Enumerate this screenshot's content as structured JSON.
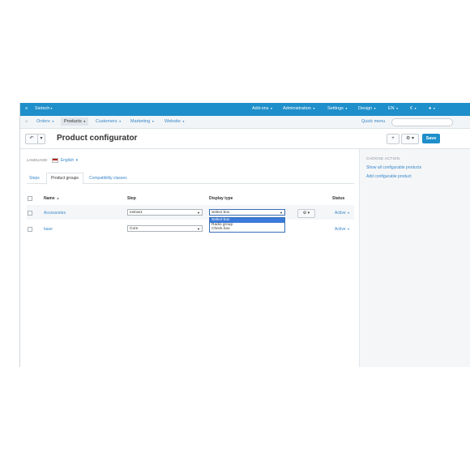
{
  "topbar": {
    "store": "Sietech",
    "menus": [
      "Add-ons",
      "Administration",
      "Settings",
      "Design",
      "EN",
      "€"
    ]
  },
  "nav2": {
    "items": [
      "Orders",
      "Products",
      "Customers",
      "Marketing",
      "Website"
    ],
    "quick_menu": "Quick menu"
  },
  "header": {
    "title": "Product configurator",
    "add_label": "+",
    "save_label": "Save"
  },
  "language": {
    "label": "LANGUAGE:",
    "value": "English"
  },
  "tabs": [
    "Steps",
    "Product groups",
    "Compatibility classes"
  ],
  "table": {
    "headers": {
      "name": "Name",
      "step": "Step",
      "display_type": "Display type",
      "status": "Status"
    },
    "rows": [
      {
        "name": "Accessories",
        "step": "extras1",
        "display_type": "Select box",
        "status": "Active"
      },
      {
        "name": "base",
        "step": "Core",
        "display_type": "",
        "status": "Active"
      }
    ]
  },
  "dropdown": {
    "options": [
      "Select box",
      "Radio group",
      "Check box"
    ],
    "selected": "Select box"
  },
  "sidebar": {
    "heading": "CHOOSE ACTION",
    "links": [
      "Show all configurable products",
      "Add configurable product"
    ]
  },
  "colors": {
    "brand": "#1e8fca",
    "link": "#3a87c8"
  }
}
